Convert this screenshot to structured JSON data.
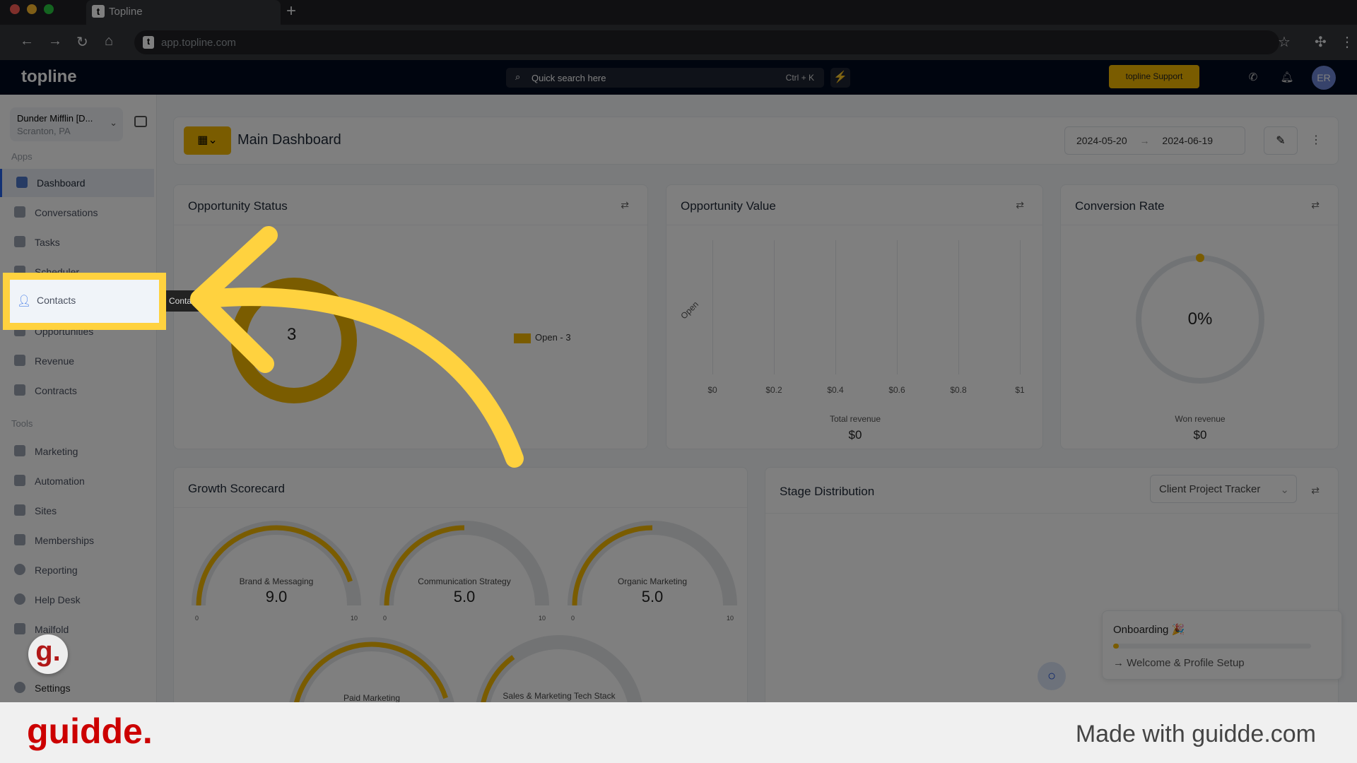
{
  "browser": {
    "tab_title": "Topline",
    "url": "app.topline.com"
  },
  "header": {
    "logo": "topline",
    "search_placeholder": "Quick search here",
    "search_shortcut": "Ctrl + K",
    "support_label": "topline Support",
    "avatar_initials": "ER"
  },
  "sidebar": {
    "account_name": "Dunder Mifflin [D...",
    "account_location": "Scranton, PA",
    "apps_label": "Apps",
    "tools_label": "Tools",
    "apps": [
      {
        "label": "Dashboard",
        "icon": "dashboard-icon"
      },
      {
        "label": "Conversations",
        "icon": "chat-icon"
      },
      {
        "label": "Tasks",
        "icon": "task-icon"
      },
      {
        "label": "Scheduler",
        "icon": "calendar-icon"
      },
      {
        "label": "Contacts",
        "icon": "person-icon"
      },
      {
        "label": "Opportunities",
        "icon": "target-icon"
      },
      {
        "label": "Revenue",
        "icon": "card-icon"
      },
      {
        "label": "Contracts",
        "icon": "document-icon"
      }
    ],
    "tools": [
      {
        "label": "Marketing",
        "icon": "megaphone-icon"
      },
      {
        "label": "Automation",
        "icon": "gears-icon"
      },
      {
        "label": "Sites",
        "icon": "globe-icon"
      },
      {
        "label": "Memberships",
        "icon": "people-icon"
      },
      {
        "label": "Reporting",
        "icon": "pie-icon"
      },
      {
        "label": "Help Desk",
        "icon": "help-icon"
      },
      {
        "label": "Mailfold",
        "icon": "mail-icon"
      }
    ],
    "settings_label": "Settings",
    "tooltip": "Contacts"
  },
  "dashboard": {
    "title": "Main Dashboard",
    "date_from": "2024-05-20",
    "date_to": "2024-06-19",
    "opportunity_status": {
      "title": "Opportunity Status",
      "total": "3",
      "legend": "Open - 3",
      "color": "#f5b800"
    },
    "opportunity_value": {
      "title": "Opportunity Value",
      "axis_label": "Open",
      "ticks": [
        "$0",
        "$0.2",
        "$0.4",
        "$0.6",
        "$0.8",
        "$1"
      ],
      "total_label": "Total revenue",
      "total_value": "$0"
    },
    "conversion_rate": {
      "title": "Conversion Rate",
      "percent": "0%",
      "won_label": "Won revenue",
      "won_value": "$0"
    },
    "growth_scorecard": {
      "title": "Growth Scorecard",
      "min": "0",
      "max": "10",
      "gauges": [
        {
          "label": "Brand & Messaging",
          "value": "9.0",
          "fraction": 0.9
        },
        {
          "label": "Communication Strategy",
          "value": "5.0",
          "fraction": 0.5
        },
        {
          "label": "Organic Marketing",
          "value": "5.0",
          "fraction": 0.5
        },
        {
          "label": "Paid Marketing",
          "value": "9.0",
          "fraction": 0.9
        },
        {
          "label": "Sales & Marketing Tech Stack",
          "value": "",
          "fraction": 0.3
        }
      ]
    },
    "stage_distribution": {
      "title": "Stage Distribution",
      "pipeline": "Client Project Tracker"
    }
  },
  "onboarding": {
    "title": "Onboarding 🎉",
    "progress": 0.03,
    "step": "Welcome & Profile Setup"
  },
  "footer": {
    "brand": "guidde.",
    "tagline": "Made with guidde.com"
  }
}
